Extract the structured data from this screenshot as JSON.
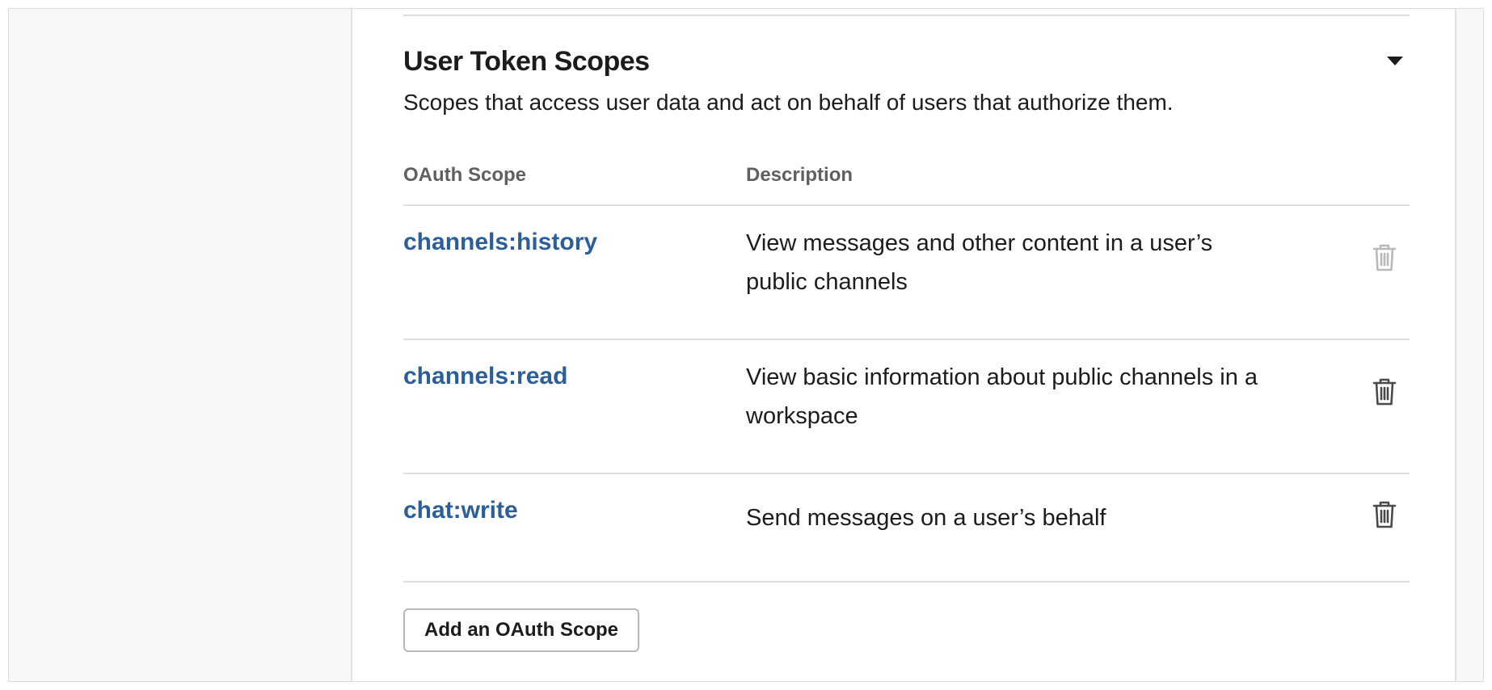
{
  "section": {
    "title": "User Token Scopes",
    "description": "Scopes that access user data and act on behalf of users that authorize them.",
    "collapse_icon": "caret-down-icon"
  },
  "table": {
    "columns": [
      "OAuth Scope",
      "Description"
    ],
    "rows": [
      {
        "scope": "channels:history",
        "description": "View messages and other content in a user’s public channels",
        "action_icon": "trash-icon",
        "action_enabled": false
      },
      {
        "scope": "channels:read",
        "description": "View basic information about public channels in a workspace",
        "action_icon": "trash-icon",
        "action_enabled": true
      },
      {
        "scope": "chat:write",
        "description": "Send messages on a user’s behalf",
        "action_icon": "trash-icon",
        "action_enabled": true
      }
    ]
  },
  "add_button": {
    "label": "Add an OAuth Scope"
  },
  "colors": {
    "link": "#2c5f99",
    "text": "#1d1c1d",
    "muted": "#616061",
    "icon_active": "#4a4a4a",
    "icon_disabled": "#b9b9b9",
    "divider": "#dedede"
  }
}
